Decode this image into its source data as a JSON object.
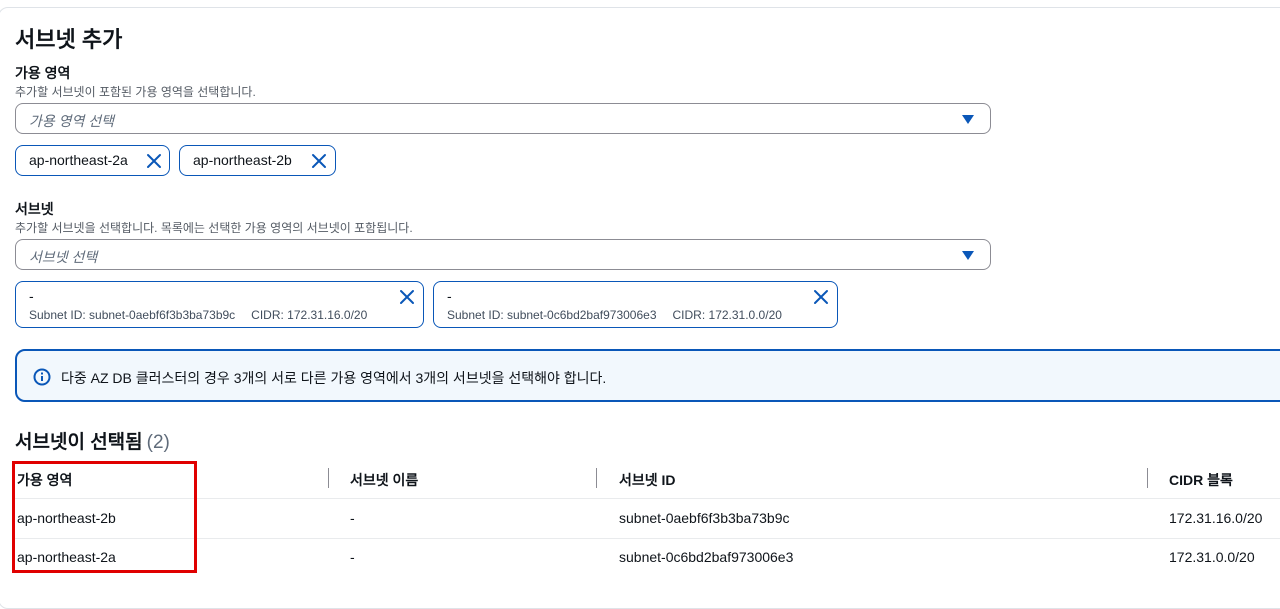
{
  "section": {
    "title": "서브넷 추가"
  },
  "availability_zone": {
    "label": "가용 영역",
    "description": "추가할 서브넷이 포함된 가용 영역을 선택합니다.",
    "placeholder": "가용 영역 선택",
    "tokens": [
      "ap-northeast-2a",
      "ap-northeast-2b"
    ]
  },
  "subnet": {
    "label": "서브넷",
    "description": "추가할 서브넷을 선택합니다. 목록에는 선택한 가용 영역의 서브넷이 포함됩니다.",
    "placeholder": "서브넷 선택",
    "tokens": [
      {
        "name": "-",
        "subnet_id": "Subnet ID: subnet-0aebf6f3b3ba73b9c",
        "cidr": "CIDR: 172.31.16.0/20"
      },
      {
        "name": "-",
        "subnet_id": "Subnet ID: subnet-0c6bd2baf973006e3",
        "cidr": "CIDR: 172.31.0.0/20"
      }
    ]
  },
  "alert": {
    "message": "다중 AZ DB 클러스터의 경우 3개의 서로 다른 가용 영역에서 3개의 서브넷을 선택해야 합니다."
  },
  "selected": {
    "title": "서브넷이 선택됨",
    "count": "(2)",
    "columns": [
      "가용 영역",
      "서브넷 이름",
      "서브넷 ID",
      "CIDR 블록"
    ],
    "rows": [
      [
        "ap-northeast-2b",
        "-",
        "subnet-0aebf6f3b3ba73b9c",
        "172.31.16.0/20"
      ],
      [
        "ap-northeast-2a",
        "-",
        "subnet-0c6bd2baf973006e3",
        "172.31.0.0/20"
      ]
    ]
  },
  "colors": {
    "accent": "#0a57b8",
    "highlight": "#e00000",
    "alert_bg": "#f2f8fd"
  }
}
